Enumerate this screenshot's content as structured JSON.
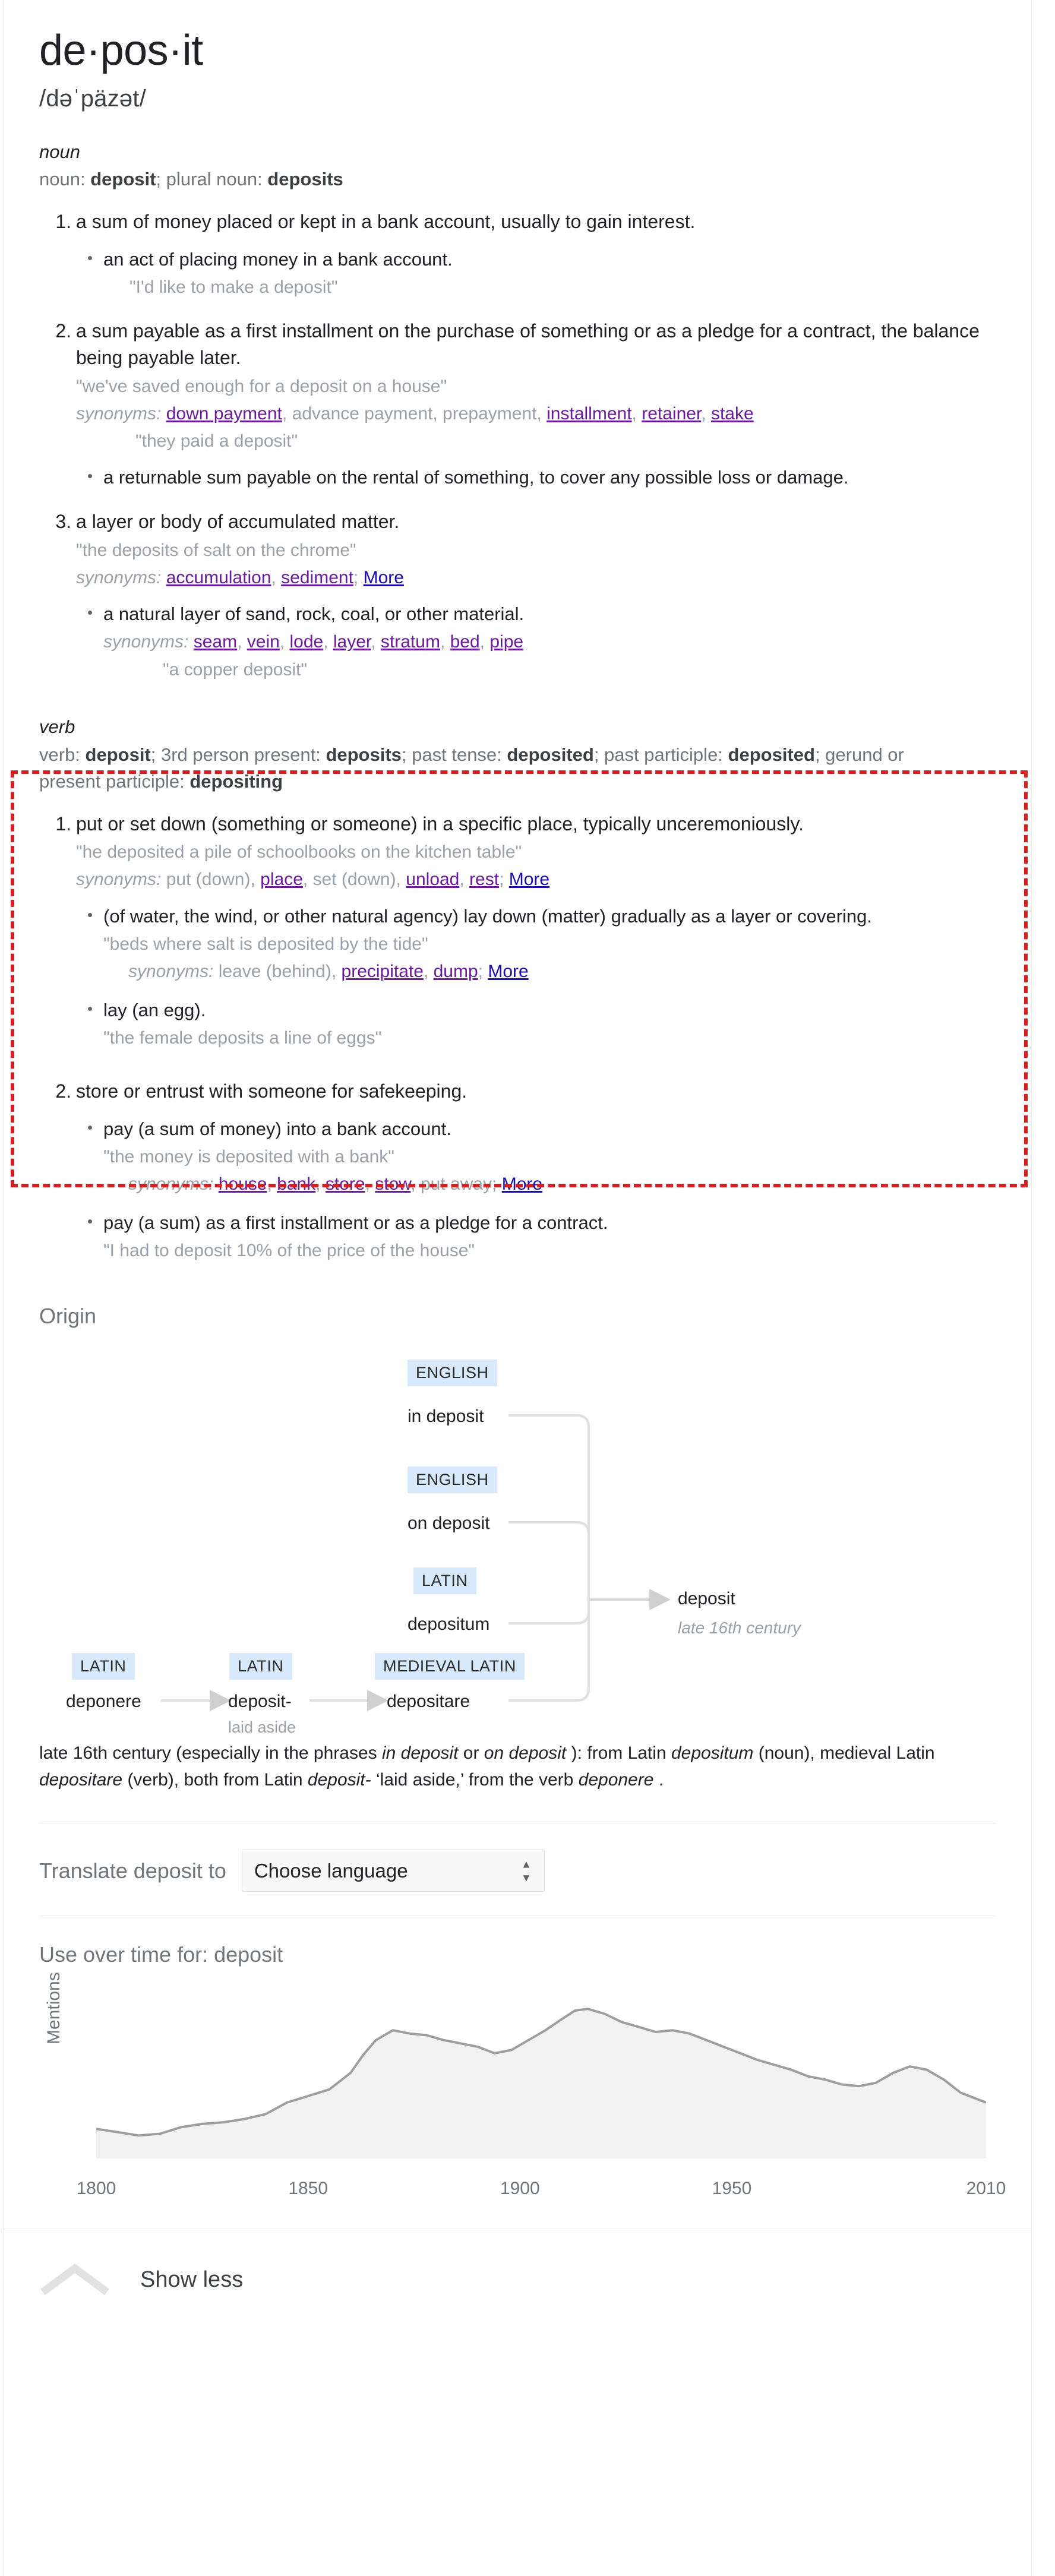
{
  "headword": "de·pos·it",
  "phonetic": "/dəˈpäzət/",
  "noun": {
    "pos_label": "noun",
    "forms_prefix": "noun: ",
    "forms_bold_1": "deposit",
    "forms_mid": "; plural noun: ",
    "forms_bold_2": "deposits",
    "senses": [
      {
        "number": "1.",
        "definition": "a sum of money placed or kept in a bank account, usually to gain interest.",
        "subsenses": [
          {
            "definition": "an act of placing money in a bank account.",
            "example": "\"I'd like to make a deposit\""
          }
        ]
      },
      {
        "number": "2.",
        "definition": "a sum payable as a first installment on the purchase of something or as a pledge for a contract, the balance being payable later.",
        "example": "\"we've saved enough for a deposit on a house\"",
        "synonyms_label": "synonyms:",
        "synonyms": [
          {
            "text": "down payment",
            "link": true
          },
          {
            "text": "advance payment",
            "link": false
          },
          {
            "text": "prepayment",
            "link": false
          },
          {
            "text": "installment",
            "link": true
          },
          {
            "text": "retainer",
            "link": true
          },
          {
            "text": "stake",
            "link": true
          }
        ],
        "synonym_example": "\"they paid a deposit\"",
        "subsenses": [
          {
            "definition": "a returnable sum payable on the rental of something, to cover any possible loss or damage."
          }
        ]
      },
      {
        "number": "3.",
        "definition": "a layer or body of accumulated matter.",
        "example": "\"the deposits of salt on the chrome\"",
        "synonyms_label": "synonyms:",
        "synonyms": [
          {
            "text": "accumulation",
            "link": true
          },
          {
            "text": "sediment",
            "link": true
          }
        ],
        "more_label": "More",
        "subsenses": [
          {
            "definition": "a natural layer of sand, rock, coal, or other material.",
            "synonyms_label": "synonyms:",
            "synonyms": [
              {
                "text": "seam",
                "link": true
              },
              {
                "text": "vein",
                "link": true
              },
              {
                "text": "lode",
                "link": true
              },
              {
                "text": "layer",
                "link": true
              },
              {
                "text": "stratum",
                "link": true
              },
              {
                "text": "bed",
                "link": true
              },
              {
                "text": "pipe",
                "link": true
              }
            ],
            "example": "\"a copper deposit\""
          }
        ]
      }
    ]
  },
  "verb": {
    "pos_label": "verb",
    "forms": "verb: deposit; 3rd person present: deposits; past tense: deposited; past participle: deposited; gerund or present participle: depositing",
    "forms_parts": [
      {
        "t": "verb: ",
        "b": false
      },
      {
        "t": "deposit",
        "b": true
      },
      {
        "t": "; 3rd person present: ",
        "b": false
      },
      {
        "t": "deposits",
        "b": true
      },
      {
        "t": "; past tense: ",
        "b": false
      },
      {
        "t": "deposited",
        "b": true
      },
      {
        "t": "; past participle: ",
        "b": false
      },
      {
        "t": "deposited",
        "b": true
      },
      {
        "t": "; gerund or present participle: ",
        "b": false
      },
      {
        "t": "depositing",
        "b": true
      }
    ],
    "senses": [
      {
        "number": "1.",
        "definition": "put or set down (something or someone) in a specific place, typically unceremoniously.",
        "example": "\"he deposited a pile of schoolbooks on the kitchen table\"",
        "synonyms_label": "synonyms:",
        "synonyms": [
          {
            "text": "put (down)",
            "link": false
          },
          {
            "text": "place",
            "link": true
          },
          {
            "text": "set (down)",
            "link": false
          },
          {
            "text": "unload",
            "link": true
          },
          {
            "text": "rest",
            "link": true
          }
        ],
        "more_label": "More",
        "subsenses": [
          {
            "definition": "(of water, the wind, or other natural agency) lay down (matter) gradually as a layer or covering.",
            "example": "\"beds where salt is deposited by the tide\"",
            "synonyms_label": "synonyms:",
            "synonyms": [
              {
                "text": "leave (behind)",
                "link": false
              },
              {
                "text": "precipitate",
                "link": true
              },
              {
                "text": "dump",
                "link": true
              }
            ],
            "more_label": "More"
          },
          {
            "definition": "lay (an egg).",
            "example": "\"the female deposits a line of eggs\""
          }
        ]
      },
      {
        "number": "2.",
        "definition": "store or entrust with someone for safekeeping.",
        "subsenses": [
          {
            "definition": "pay (a sum of money) into a bank account.",
            "example": "\"the money is deposited with a bank\"",
            "synonyms_label": "synonyms:",
            "synonyms": [
              {
                "text": "house",
                "link": true
              },
              {
                "text": "bank",
                "link": true
              },
              {
                "text": "store",
                "link": true
              },
              {
                "text": "stow",
                "link": true
              },
              {
                "text": "put away",
                "link": false
              }
            ],
            "more_label": "More"
          },
          {
            "definition": "pay (a sum) as a first installment or as a pledge for a contract.",
            "example": "\"I had to deposit 10% of the price of the house\""
          }
        ]
      }
    ]
  },
  "origin": {
    "heading": "Origin",
    "tree": {
      "nodes": [
        {
          "id": "n1",
          "lang": "ENGLISH",
          "term": "in deposit",
          "gloss": ""
        },
        {
          "id": "n2",
          "lang": "ENGLISH",
          "term": "on deposit",
          "gloss": ""
        },
        {
          "id": "n3",
          "lang": "LATIN",
          "term": "depositum",
          "gloss": ""
        },
        {
          "id": "n4",
          "lang": "LATIN",
          "term": "deponere",
          "gloss": ""
        },
        {
          "id": "n5",
          "lang": "LATIN",
          "term": "deposit-",
          "gloss": "laid aside"
        },
        {
          "id": "n6",
          "lang": "MEDIEVAL LATIN",
          "term": "depositare",
          "gloss": ""
        }
      ],
      "result_term": "deposit",
      "result_date": "late 16th century"
    },
    "text_parts": [
      {
        "t": "late 16th century (especially in the phrases ",
        "i": false
      },
      {
        "t": "in deposit",
        "i": true
      },
      {
        "t": " or ",
        "i": false
      },
      {
        "t": "on deposit",
        "i": true
      },
      {
        "t": " ): from Latin ",
        "i": false
      },
      {
        "t": "depositum",
        "i": true
      },
      {
        "t": " (noun), medieval Latin ",
        "i": false
      },
      {
        "t": "depositare",
        "i": true
      },
      {
        "t": " (verb), both from Latin ",
        "i": false
      },
      {
        "t": "deposit-",
        "i": true
      },
      {
        "t": " ‘laid aside,’ from the verb ",
        "i": false
      },
      {
        "t": "deponere",
        "i": true
      },
      {
        "t": " .",
        "i": false
      }
    ]
  },
  "translate": {
    "label": "Translate deposit to",
    "selected": "Choose language",
    "options": [
      "Choose language"
    ]
  },
  "chart_data": {
    "type": "area",
    "title": "Use over time for: deposit",
    "xlabel": "",
    "ylabel": "Mentions",
    "xlim": [
      1800,
      2010
    ],
    "ylim": [
      0,
      100
    ],
    "grid": false,
    "legend": "none",
    "tick_labels": [
      "1800",
      "1850",
      "1900",
      "1950",
      "2010"
    ],
    "tick_values": [
      1800,
      1850,
      1900,
      1950,
      2010
    ],
    "x": [
      1800,
      1805,
      1810,
      1815,
      1820,
      1825,
      1830,
      1835,
      1840,
      1845,
      1850,
      1855,
      1860,
      1863,
      1866,
      1870,
      1874,
      1878,
      1882,
      1886,
      1890,
      1894,
      1898,
      1902,
      1906,
      1910,
      1913,
      1916,
      1920,
      1924,
      1928,
      1932,
      1936,
      1940,
      1944,
      1948,
      1952,
      1956,
      1960,
      1964,
      1968,
      1972,
      1976,
      1980,
      1984,
      1988,
      1992,
      1996,
      2000,
      2004,
      2010
    ],
    "values": [
      18,
      16,
      14,
      15,
      19,
      21,
      22,
      24,
      27,
      34,
      38,
      42,
      52,
      63,
      72,
      78,
      76,
      75,
      72,
      70,
      68,
      64,
      66,
      72,
      78,
      85,
      90,
      91,
      88,
      83,
      80,
      77,
      78,
      76,
      72,
      68,
      64,
      60,
      57,
      54,
      50,
      48,
      45,
      44,
      46,
      52,
      56,
      54,
      48,
      40,
      34
    ]
  },
  "footer": {
    "show_less_label": "Show less"
  }
}
